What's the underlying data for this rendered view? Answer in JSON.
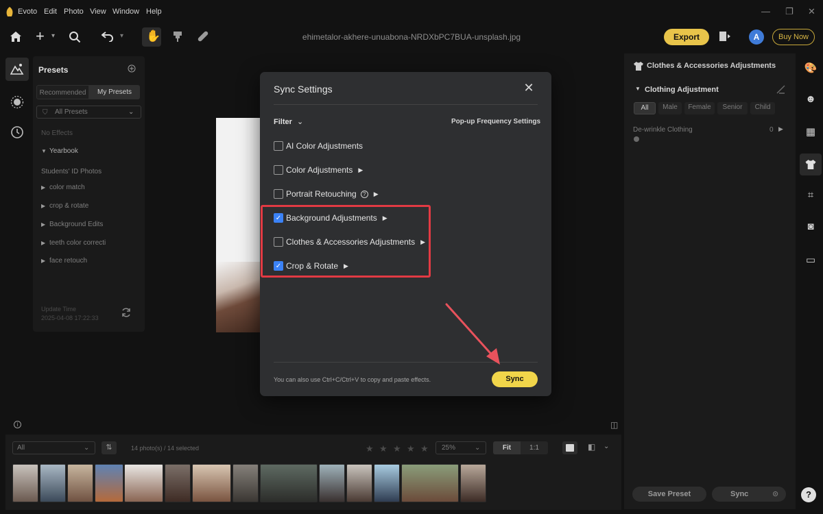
{
  "app": {
    "name": "Evoto",
    "menu": [
      "Edit",
      "Photo",
      "View",
      "Window",
      "Help"
    ],
    "file_name": "ehimetalor-akhere-unuabona-NRDXbPC7BUA-unsplash.jpg",
    "export_label": "Export",
    "avatar_letter": "A",
    "buy_now_label": "Buy Now"
  },
  "presets": {
    "title": "Presets",
    "tabs": [
      "Recommended",
      "My Presets"
    ],
    "filter_value": "All Presets",
    "no_effects": "No Effects",
    "yearbook": "Yearbook",
    "group_label": "Students' ID Photos",
    "items": [
      "color match",
      "crop & rotate",
      "Background Edits",
      "teeth color correcti",
      "face retouch"
    ],
    "update_label": "Update Time",
    "update_time": "2025-04-08 17:22:33"
  },
  "right_panel": {
    "title": "Clothes & Accessories Adjustments",
    "section": "Clothing Adjustment",
    "chips": [
      "All",
      "Male",
      "Female",
      "Senior",
      "Child"
    ],
    "slider_label": "De-wrinkle Clothing",
    "slider_value": "0",
    "save_preset_label": "Save Preset",
    "sync_label": "Sync"
  },
  "filmstrip": {
    "filter_value": "All",
    "count_text": "14 photo(s) / 14 selected",
    "zoom_value": "25%",
    "fit_label": "Fit",
    "one_to_one_label": "1:1",
    "stars_max": 5
  },
  "modal": {
    "title": "Sync Settings",
    "filter_label": "Filter",
    "popup_settings_label": "Pop-up Frequency Settings",
    "options": [
      {
        "label": "AI Color Adjustments",
        "checked": false,
        "expandable": false,
        "help": false
      },
      {
        "label": "Color Adjustments",
        "checked": false,
        "expandable": true,
        "help": false
      },
      {
        "label": "Portrait Retouching",
        "checked": false,
        "expandable": true,
        "help": true
      },
      {
        "label": "Background Adjustments",
        "checked": true,
        "expandable": true,
        "help": false
      },
      {
        "label": "Clothes & Accessories Adjustments",
        "checked": false,
        "expandable": true,
        "help": false
      },
      {
        "label": "Crop & Rotate",
        "checked": true,
        "expandable": true,
        "help": false
      }
    ],
    "hint": "You can also use Ctrl+C/Ctrl+V to copy and paste effects.",
    "sync_label": "Sync"
  },
  "colors": {
    "accent_yellow": "#f1d54a",
    "checkbox_blue": "#3b82f6",
    "highlight_red": "#e23a43"
  }
}
